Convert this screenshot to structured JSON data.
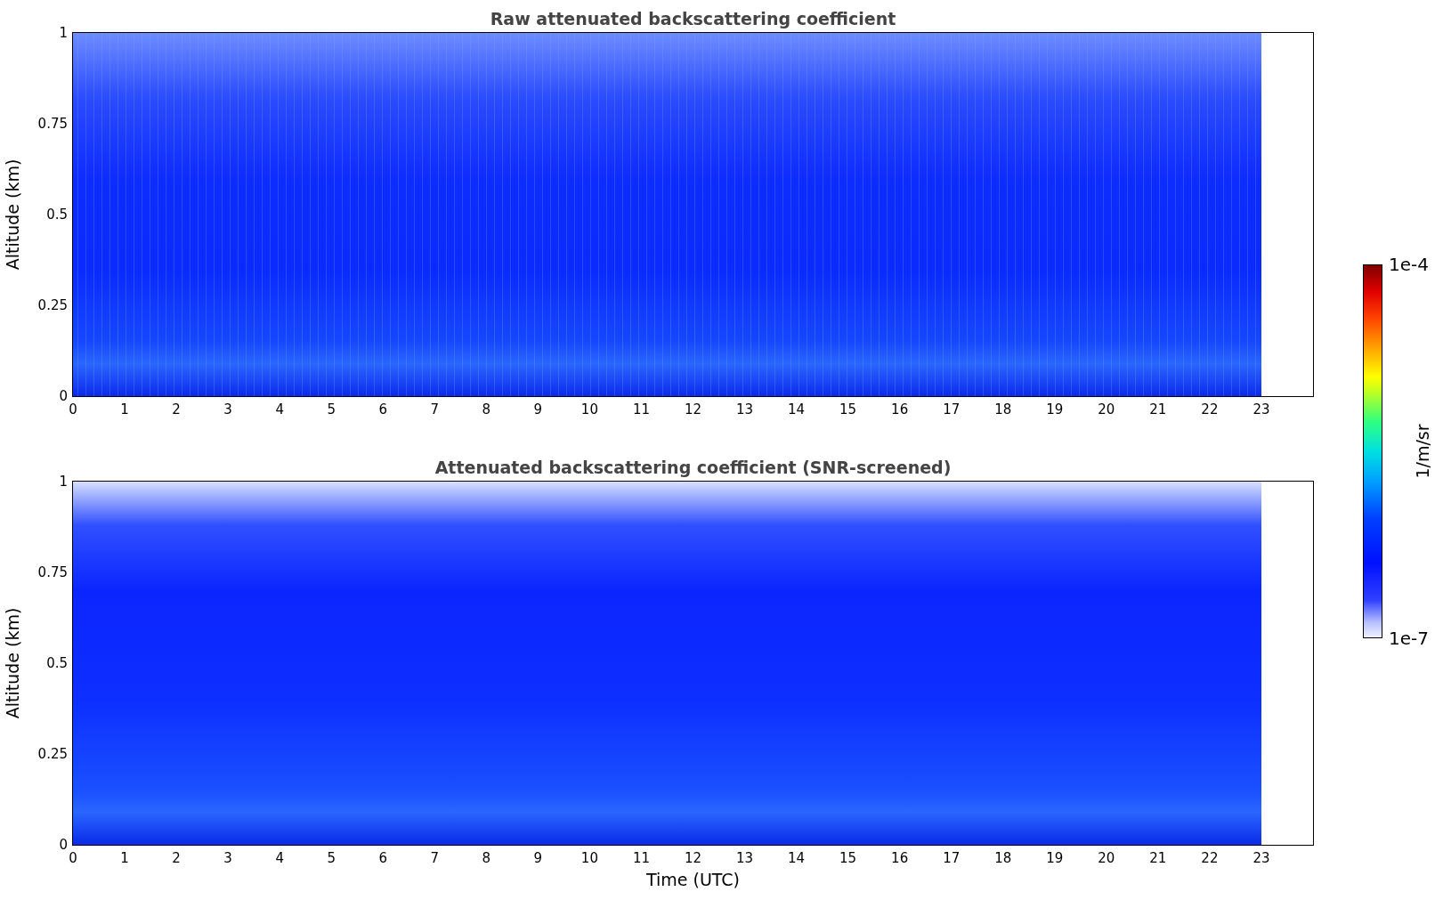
{
  "panels": [
    {
      "title": "Raw attenuated backscattering coefficient",
      "ylabel": "Altitude (km)",
      "yticks": [
        "1",
        "0.75",
        "0.5",
        "0.25",
        "0"
      ],
      "xticks": [
        "0",
        "1",
        "2",
        "3",
        "4",
        "5",
        "6",
        "7",
        "8",
        "9",
        "10",
        "11",
        "12",
        "13",
        "14",
        "15",
        "16",
        "17",
        "18",
        "19",
        "20",
        "21",
        "22",
        "23"
      ]
    },
    {
      "title": "Attenuated backscattering coefficient (SNR-screened)",
      "ylabel": "Altitude (km)",
      "yticks": [
        "1",
        "0.75",
        "0.5",
        "0.25",
        "0"
      ],
      "xticks": [
        "0",
        "1",
        "2",
        "3",
        "4",
        "5",
        "6",
        "7",
        "8",
        "9",
        "10",
        "11",
        "12",
        "13",
        "14",
        "15",
        "16",
        "17",
        "18",
        "19",
        "20",
        "21",
        "22",
        "23"
      ],
      "xlabel": "Time (UTC)"
    }
  ],
  "colorbar": {
    "max": "1e-4",
    "min": "1e-7",
    "label": "1/m/sr"
  }
}
